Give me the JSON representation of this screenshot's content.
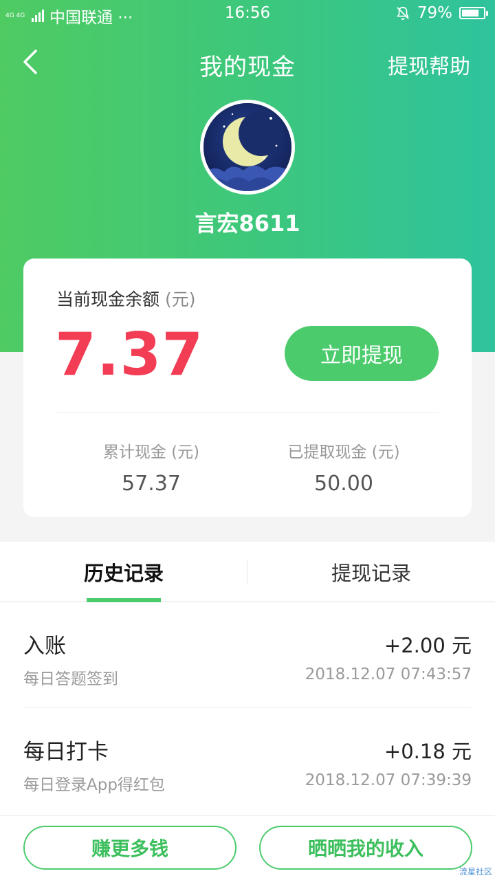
{
  "status_bar": {
    "network": "4G 4G",
    "carrier": "中国联通 ···",
    "time": "16:56",
    "battery_text": "79%",
    "battery_level": 0.79
  },
  "header": {
    "title": "我的现金",
    "help_label": "提现帮助",
    "back_icon": "chevron-left-icon"
  },
  "profile": {
    "username": "言宏8611",
    "avatar_icon": "crescent-moon-avatar"
  },
  "balance": {
    "label": "当前现金余额",
    "unit": "(元)",
    "amount": "7.37",
    "withdraw_label": "立即提现",
    "total_label": "累计现金 (元)",
    "total_value": "57.37",
    "withdrawn_label": "已提取现金 (元)",
    "withdrawn_value": "50.00"
  },
  "tabs": [
    {
      "label": "历史记录",
      "active": true
    },
    {
      "label": "提现记录",
      "active": false
    }
  ],
  "records": [
    {
      "title": "入账",
      "amount": "+2.00 元",
      "desc": "每日答题签到",
      "time": "2018.12.07 07:43:57"
    },
    {
      "title": "每日打卡",
      "amount": "+0.18 元",
      "desc": "每日登录App得红包",
      "time": "2018.12.07 07:39:39"
    }
  ],
  "bottom": {
    "earn_more_label": "赚更多钱",
    "share_income_label": "晒晒我的收入"
  },
  "watermark": "流星社区",
  "colors": {
    "brand_green": "#4ccb6d",
    "gradient_start": "#4fcb62",
    "gradient_end": "#2fc39d",
    "amount_red": "#f33d54"
  }
}
